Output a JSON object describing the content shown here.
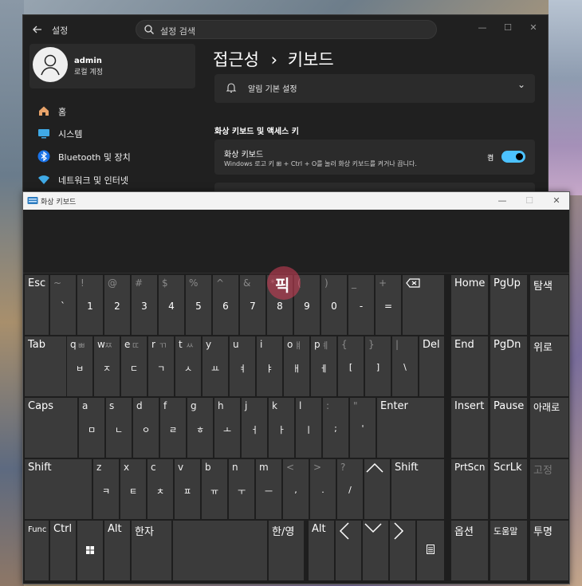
{
  "settings": {
    "app_title": "설정",
    "search_placeholder": "설정 검색",
    "user": {
      "name": "admin",
      "type": "로컬 계정"
    },
    "nav": [
      {
        "label": "홈",
        "icon": "home-icon"
      },
      {
        "label": "시스템",
        "icon": "display-icon"
      },
      {
        "label": "Bluetooth 및 장치",
        "icon": "bluetooth-icon"
      },
      {
        "label": "네트워크 및 인터넷",
        "icon": "wifi-icon"
      }
    ],
    "breadcrumb_parent": "접근성",
    "breadcrumb_sep": "›",
    "breadcrumb_current": "키보드",
    "notification_row": "알림 기본 설정",
    "section_title": "화상 키보드 및 액세스 키",
    "osk_setting": {
      "title": "화상 키보드",
      "description": "Windows 로고 키 ⊞ + Ctrl + O를 눌러 화상 키보드를 켜거나 끕니다.",
      "state": "켬",
      "enabled": true
    },
    "colors": {
      "accent": "#4cc2ff",
      "window_bg": "#202020",
      "card_bg": "#2b2b2b"
    }
  },
  "osk": {
    "title": "화상 키보드",
    "watermark": "픽",
    "keys": {
      "esc": "Esc",
      "num": [
        {
          "shift": "~",
          "base": "`"
        },
        {
          "shift": "!",
          "base": "1"
        },
        {
          "shift": "@",
          "base": "2"
        },
        {
          "shift": "#",
          "base": "3"
        },
        {
          "shift": "$",
          "base": "4"
        },
        {
          "shift": "%",
          "base": "5"
        },
        {
          "shift": "^",
          "base": "6"
        },
        {
          "shift": "&",
          "base": "7"
        },
        {
          "shift": "*",
          "base": "8"
        },
        {
          "shift": "(",
          "base": "9"
        },
        {
          "shift": ")",
          "base": "0"
        },
        {
          "shift": "_",
          "base": "-"
        },
        {
          "shift": "+",
          "base": "="
        }
      ],
      "home": "Home",
      "pgup": "PgUp",
      "hangul": "탐색",
      "tab": "Tab",
      "q_row": [
        {
          "en": "q",
          "kor_shift": "ㅃ",
          "kor": "ㅂ"
        },
        {
          "en": "w",
          "kor_shift": "ㅉ",
          "kor": "ㅈ"
        },
        {
          "en": "e",
          "kor_shift": "ㄸ",
          "kor": "ㄷ"
        },
        {
          "en": "r",
          "kor_shift": "ㄲ",
          "kor": "ㄱ"
        },
        {
          "en": "t",
          "kor_shift": "ㅆ",
          "kor": "ㅅ"
        },
        {
          "en": "y",
          "kor_shift": "",
          "kor": "ㅛ"
        },
        {
          "en": "u",
          "kor_shift": "",
          "kor": "ㅕ"
        },
        {
          "en": "i",
          "kor_shift": "",
          "kor": "ㅑ"
        },
        {
          "en": "o",
          "kor_shift": "ㅒ",
          "kor": "ㅐ"
        },
        {
          "en": "p",
          "kor_shift": "ㅖ",
          "kor": "ㅔ"
        },
        {
          "en": "{",
          "kor_shift": "",
          "kor": "["
        },
        {
          "en": "}",
          "kor_shift": "",
          "kor": "]"
        },
        {
          "en": "|",
          "kor_shift": "",
          "kor": "\\"
        }
      ],
      "del": "Del",
      "end": "End",
      "pgdn": "PgDn",
      "up_kor": "위로",
      "caps": "Caps",
      "a_row": [
        {
          "en": "a",
          "kor": "ㅁ"
        },
        {
          "en": "s",
          "kor": "ㄴ"
        },
        {
          "en": "d",
          "kor": "ㅇ"
        },
        {
          "en": "f",
          "kor": "ㄹ"
        },
        {
          "en": "g",
          "kor": "ㅎ"
        },
        {
          "en": "h",
          "kor": "ㅗ"
        },
        {
          "en": "j",
          "kor": "ㅓ"
        },
        {
          "en": "k",
          "kor": "ㅏ"
        },
        {
          "en": "l",
          "kor": "ㅣ"
        },
        {
          "en": ":",
          "kor": ";"
        },
        {
          "en": "\"",
          "kor": "'"
        }
      ],
      "enter": "Enter",
      "insert": "Insert",
      "pause": "Pause",
      "down_kor": "아래로",
      "shift": "Shift",
      "z_row": [
        {
          "en": "z",
          "kor": "ㅋ"
        },
        {
          "en": "x",
          "kor": "ㅌ"
        },
        {
          "en": "c",
          "kor": "ㅊ"
        },
        {
          "en": "v",
          "kor": "ㅍ"
        },
        {
          "en": "b",
          "kor": "ㅠ"
        },
        {
          "en": "n",
          "kor": "ㅜ"
        },
        {
          "en": "m",
          "kor": "ㅡ"
        },
        {
          "en": "<",
          "kor": ","
        },
        {
          "en": ">",
          "kor": "."
        },
        {
          "en": "?",
          "kor": "/"
        }
      ],
      "shift_r": "Shift",
      "prtscn": "PrtScn",
      "scrlk": "ScrLk",
      "fix_kor": "고정",
      "fn": "Func",
      "ctrl": "Ctrl",
      "alt": "Alt",
      "hanja": "한자",
      "hanyoung": "한/영",
      "alt_r": "Alt",
      "options_kor": "옵션",
      "help_kor": "도움말",
      "fade_kor": "투명"
    }
  }
}
